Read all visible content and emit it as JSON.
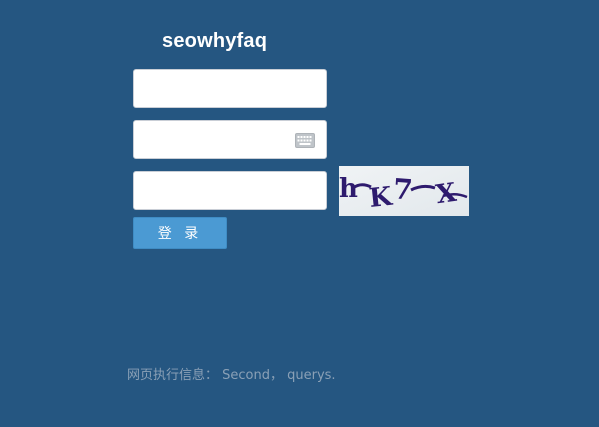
{
  "app": {
    "title": "seowhyfaq"
  },
  "form": {
    "username_value": "",
    "password_value": "",
    "captcha_value": "",
    "password_keyboard_icon": "keyboard-icon",
    "captcha_text": "h-K7-X",
    "login_label": "登 录"
  },
  "footer": {
    "text": "网页执行信息： Second， querys."
  },
  "colors": {
    "background": "#255681",
    "button": "#4b9ad3",
    "captcha_ink": "#2e1b6e",
    "captcha_bg": "#e7ecef"
  }
}
